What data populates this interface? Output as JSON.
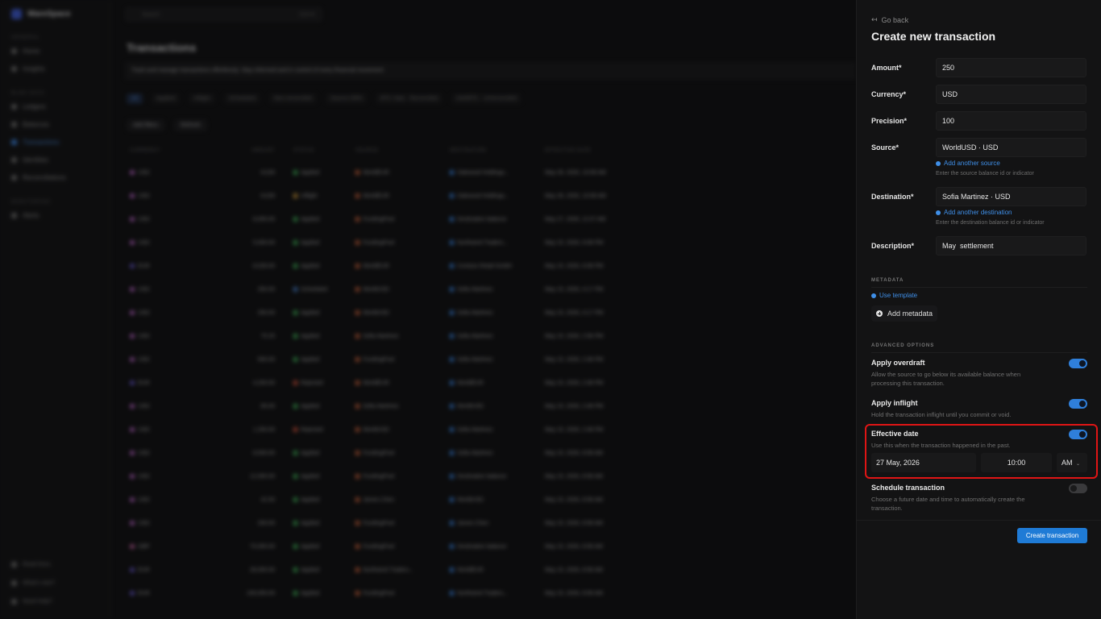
{
  "background": {
    "workspace": "WareSpace",
    "search_placeholder": "Search",
    "search_shortcut": "Ctrl+K",
    "nav_groups": [
      {
        "label": "GENERAL",
        "items": [
          "Home",
          "Insights"
        ]
      },
      {
        "label": "BLNK DATA",
        "items": [
          "Ledgers",
          "Balances",
          "Transactions",
          "Identities",
          "Reconciliations"
        ]
      },
      {
        "label": "MONITORING",
        "items": [
          "Alerts"
        ]
      }
    ],
    "bottom_items": [
      "Read Docs",
      "What's new?",
      "Need Help?"
    ],
    "page_title": "Transactions",
    "banner": "Track and manage transactions effortlessly. Stay informed and in control of every financial movement",
    "filters": [
      "All",
      "Applied",
      "Inflight",
      "Scheduled",
      "Non-reconciled",
      "Source DRN",
      "BTC Sats · Reconciled",
      "DAI/BTC · Unreconciled"
    ],
    "buttons": [
      "Add filters",
      "Refresh"
    ],
    "columns": [
      "CURRENCY",
      "AMOUNT",
      "STATUS",
      "SOURCE",
      "DESTINATION",
      "EFFECTIVE DATE"
    ],
    "rows": [
      {
        "cur": "USD",
        "amt": "8,028",
        "status": "Applied",
        "src": "WorldEUR",
        "dst": "Oakwood Holdings...",
        "date": "May 28, 2026, 10:08 AM",
        "sc": "#3fbf5a",
        "cc": "#c96bd8"
      },
      {
        "cur": "USD",
        "amt": "8,028",
        "status": "Inflight",
        "src": "WorldEUR",
        "dst": "Oakwood Holdings...",
        "date": "May 28, 2026, 10:08 AM",
        "sc": "#e0a63a",
        "cc": "#c96bd8"
      },
      {
        "cur": "USD",
        "amt": "8,000.00",
        "status": "Applied",
        "src": "FundingPool",
        "dst": "Destination balance",
        "date": "May 27, 2026, 11:07 AM",
        "sc": "#3fbf5a",
        "cc": "#c96bd8"
      },
      {
        "cur": "USD",
        "amt": "5,000.00",
        "status": "Applied",
        "src": "FundingPool",
        "dst": "Northwind Traders...",
        "date": "May 15, 2026, 6:08 PM",
        "sc": "#3fbf5a",
        "cc": "#c96bd8"
      },
      {
        "cur": "EUR",
        "amt": "8,028.00",
        "status": "Applied",
        "src": "WorldEUR",
        "dst": "Contoso Retail GmbH",
        "date": "May 15, 2026, 6:08 PM",
        "sc": "#3fbf5a",
        "cc": "#6a5ad8"
      },
      {
        "cur": "USD",
        "amt": "250.00",
        "status": "Scheduled",
        "src": "WorldUSD",
        "dst": "Sofia Martinez",
        "date": "May 15, 2026, 4:17 PM",
        "sc": "#4a8be0",
        "cc": "#c96bd8"
      },
      {
        "cur": "USD",
        "amt": "250.00",
        "status": "Applied",
        "src": "WorldUSD",
        "dst": "Sofia Martinez",
        "date": "May 15, 2026, 4:17 PM",
        "sc": "#3fbf5a",
        "cc": "#c96bd8"
      },
      {
        "cur": "USD",
        "amt": "75.25",
        "status": "Applied",
        "src": "Sofia Martinez",
        "dst": "Sofia Martinez",
        "date": "May 15, 2026, 2:56 PM",
        "sc": "#3fbf5a",
        "cc": "#c96bd8"
      },
      {
        "cur": "USD",
        "amt": "500.00",
        "status": "Applied",
        "src": "FundingPool",
        "dst": "Sofia Martinez",
        "date": "May 15, 2026, 2:48 PM",
        "sc": "#3fbf5a",
        "cc": "#c96bd8"
      },
      {
        "cur": "EUR",
        "amt": "4,200.00",
        "status": "Rejected",
        "src": "WorldEUR",
        "dst": "WorldEUR",
        "date": "May 15, 2026, 2:48 PM",
        "sc": "#e0553a",
        "cc": "#6a5ad8"
      },
      {
        "cur": "USD",
        "amt": "85.00",
        "status": "Applied",
        "src": "Sofia Martinez",
        "dst": "WorldUSD",
        "date": "May 15, 2026, 2:48 PM",
        "sc": "#3fbf5a",
        "cc": "#c96bd8"
      },
      {
        "cur": "USD",
        "amt": "1,250.00",
        "status": "Rejected",
        "src": "WorldUSD",
        "dst": "Sofia Martinez",
        "date": "May 15, 2026, 2:48 PM",
        "sc": "#e0553a",
        "cc": "#c96bd8"
      },
      {
        "cur": "USD",
        "amt": "8,500.00",
        "status": "Applied",
        "src": "FundingPool",
        "dst": "Sofia Martinez",
        "date": "May 15, 2026, 8:58 AM",
        "sc": "#3fbf5a",
        "cc": "#c96bd8"
      },
      {
        "cur": "USD",
        "amt": "12,000.00",
        "status": "Applied",
        "src": "FundingPool",
        "dst": "Destination balance",
        "date": "May 15, 2026, 8:58 AM",
        "sc": "#3fbf5a",
        "cc": "#c96bd8"
      },
      {
        "cur": "USD",
        "amt": "42.50",
        "status": "Applied",
        "src": "James Chen",
        "dst": "WorldUSD",
        "date": "May 15, 2026, 8:58 AM",
        "sc": "#3fbf5a",
        "cc": "#c96bd8"
      },
      {
        "cur": "USD",
        "amt": "200.00",
        "status": "Applied",
        "src": "FundingPool",
        "dst": "James Chen",
        "date": "May 15, 2026, 8:58 AM",
        "sc": "#3fbf5a",
        "cc": "#c96bd8"
      },
      {
        "cur": "GBP",
        "amt": "75,000.00",
        "status": "Applied",
        "src": "FundingPool",
        "dst": "Destination balance",
        "date": "May 15, 2026, 8:58 AM",
        "sc": "#3fbf5a",
        "cc": "#d86ab0"
      },
      {
        "cur": "EUR",
        "amt": "28,000.00",
        "status": "Applied",
        "src": "Northwind Traders...",
        "dst": "WorldEUR",
        "date": "May 15, 2026, 8:58 AM",
        "sc": "#3fbf5a",
        "cc": "#6a5ad8"
      },
      {
        "cur": "EUR",
        "amt": "100,000.00",
        "status": "Applied",
        "src": "FundingPool",
        "dst": "Northwind Traders...",
        "date": "May 15, 2026, 8:58 AM",
        "sc": "#3fbf5a",
        "cc": "#6a5ad8"
      }
    ]
  },
  "panel": {
    "go_back": "Go back",
    "title": "Create new transaction",
    "amount": {
      "label": "Amount*",
      "value": "250"
    },
    "currency": {
      "label": "Currency*",
      "value": "USD"
    },
    "precision": {
      "label": "Precision*",
      "value": "100"
    },
    "source": {
      "label": "Source*",
      "value": "WorldUSD · USD",
      "link": "Add another source",
      "help": "Enter the source balance id or indicator"
    },
    "destination": {
      "label": "Destination*",
      "value": "Sofia Martinez · USD",
      "link": "Add another destination",
      "help": "Enter the destination balance id or indicator"
    },
    "description": {
      "label": "Description*",
      "value": "May  settlement"
    },
    "metadata": {
      "heading": "METADATA",
      "use_template": "Use template",
      "add": "Add metadata"
    },
    "advanced": {
      "heading": "ADVANCED OPTIONS",
      "overdraft": {
        "title": "Apply overdraft",
        "desc": "Allow the source to go below its available balance when processing this transaction.",
        "on": true
      },
      "inflight": {
        "title": "Apply inflight",
        "desc": "Hold the transaction inflight until you commit or void.",
        "on": true
      },
      "effective": {
        "title": "Effective date",
        "desc": "Use this when the transaction happened in the past.",
        "on": true,
        "date": "27 May, 2026",
        "time": "10:00",
        "ampm": "AM"
      },
      "schedule": {
        "title": "Schedule transaction",
        "desc": "Choose a future date and time to automatically create the transaction.",
        "on": false
      }
    },
    "submit": "Create transaction",
    "accent_color": "#1f7bd6",
    "highlight_color": "#e01515"
  }
}
